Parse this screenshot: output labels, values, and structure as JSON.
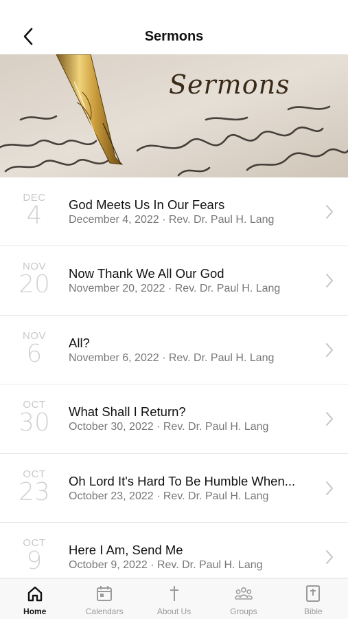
{
  "header": {
    "title": "Sermons",
    "back_icon": "chevron-left-icon"
  },
  "banner": {
    "title": "Sermons"
  },
  "sermons": [
    {
      "month": "DEC",
      "day": "4",
      "title": "God Meets Us In Our Fears",
      "subtitle": "December 4, 2022 · Rev. Dr. Paul H. Lang"
    },
    {
      "month": "NOV",
      "day": "20",
      "title": "Now Thank We All Our God",
      "subtitle": "November 20, 2022 · Rev. Dr. Paul H. Lang"
    },
    {
      "month": "NOV",
      "day": "6",
      "title": "All?",
      "subtitle": "November 6, 2022 · Rev. Dr. Paul H. Lang"
    },
    {
      "month": "OCT",
      "day": "30",
      "title": "What Shall I Return?",
      "subtitle": "October 30, 2022 · Rev. Dr. Paul H. Lang"
    },
    {
      "month": "OCT",
      "day": "23",
      "title": "Oh Lord It's Hard To Be Humble When...",
      "subtitle": "October 23, 2022 · Rev. Dr. Paul H. Lang"
    },
    {
      "month": "OCT",
      "day": "9",
      "title": "Here I Am, Send Me",
      "subtitle": "October 9, 2022 · Rev. Dr. Paul H. Lang"
    }
  ],
  "tabs": [
    {
      "label": "Home",
      "icon": "home-icon",
      "active": true
    },
    {
      "label": "Calendars",
      "icon": "calendar-icon",
      "active": false
    },
    {
      "label": "About Us",
      "icon": "cross-icon",
      "active": false
    },
    {
      "label": "Groups",
      "icon": "groups-icon",
      "active": false
    },
    {
      "label": "Bible",
      "icon": "bible-icon",
      "active": false
    }
  ]
}
